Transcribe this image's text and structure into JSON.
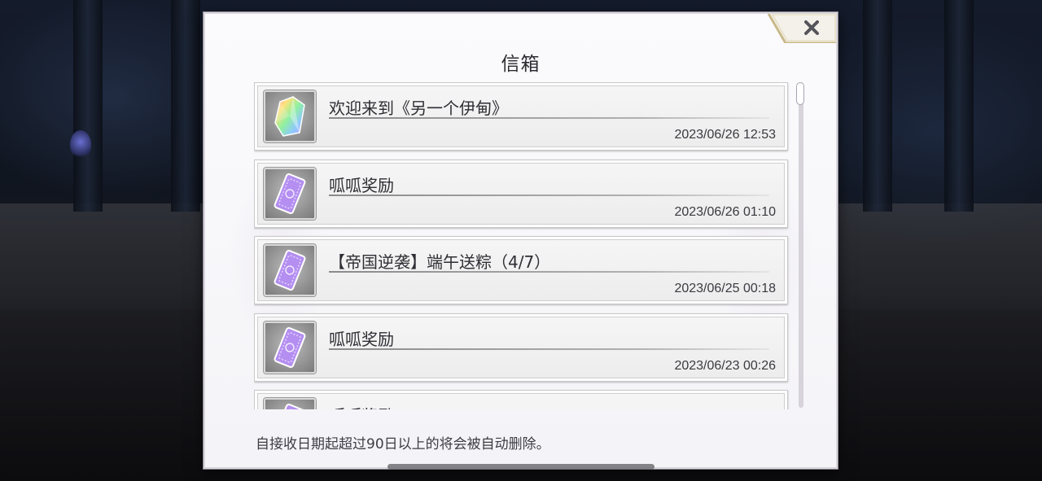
{
  "dialog": {
    "title": "信箱",
    "close_icon": "close-x-icon",
    "footer_note": "自接收日期起超过90日以上的将会被自动删除。"
  },
  "mails": [
    {
      "icon": "rainbow-crystal-icon",
      "title": "欢迎来到《另一个伊甸》",
      "date": "2023/06/26 12:53"
    },
    {
      "icon": "purple-ticket-icon",
      "title": "呱呱奖励",
      "date": "2023/06/26 01:10"
    },
    {
      "icon": "purple-ticket-icon",
      "title": "【帝国逆袭】端午送粽（4/7）",
      "date": "2023/06/25 00:18"
    },
    {
      "icon": "purple-ticket-icon",
      "title": "呱呱奖励",
      "date": "2023/06/23 00:26"
    },
    {
      "icon": "purple-ticket-icon",
      "title": "呱呱奖励",
      "date": ""
    }
  ],
  "colors": {
    "dialog_bg": "#f8f7fa",
    "close_tab_gold": "#c9b98a",
    "ticket_purple": "#b48ef0",
    "text_dark": "#2e2e34"
  }
}
